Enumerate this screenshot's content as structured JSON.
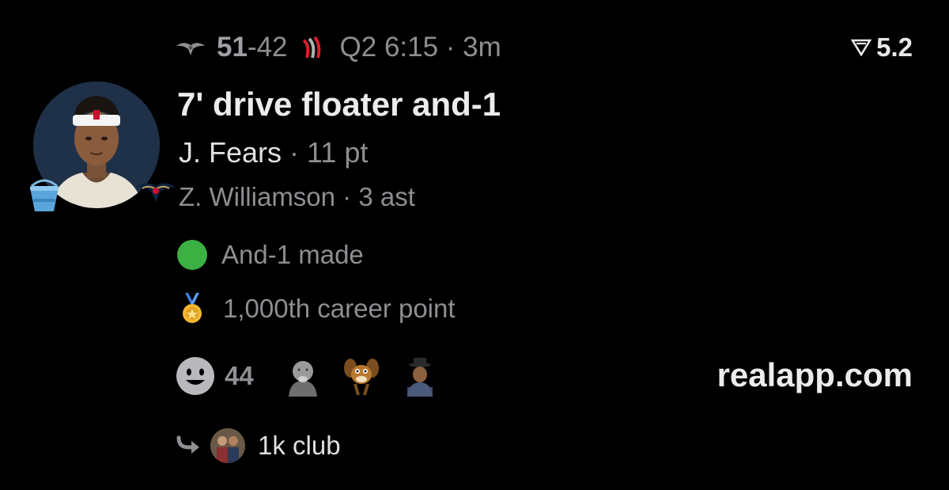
{
  "header": {
    "away_team_logo_icon": "pelicans-logo-icon",
    "score_home": "51",
    "score_dash": "-",
    "score_away": "42",
    "home_team_logo_icon": "blazers-logo-icon",
    "clock": "Q2 6:15 · 3m"
  },
  "rating": {
    "icon": "rating-triangle-icon",
    "value": "5.2"
  },
  "play": {
    "title": "7' drive floater and-1",
    "scorer_name": "J. Fears",
    "separator": " · ",
    "scorer_stat": "11 pt",
    "assist_line": "Z. Williamson · 3 ast"
  },
  "tags": [
    {
      "icon": "green-circle-icon",
      "label": "And-1 made",
      "color": "#3cb043"
    },
    {
      "icon": "medal-icon",
      "label": "1,000th career point"
    }
  ],
  "reactions": {
    "icon": "smiley-icon",
    "count": "44",
    "faces": [
      "baby-face-icon",
      "cartoon-dog-icon",
      "man-in-hat-icon"
    ]
  },
  "watermark": "realapp.com",
  "thread": {
    "icon": "reply-arrow-icon",
    "label": "1k club"
  },
  "colors": {
    "background": "#000000",
    "primary_text": "#e8e8e8",
    "secondary_text": "#8e8e93",
    "accent_green": "#3cb043"
  }
}
